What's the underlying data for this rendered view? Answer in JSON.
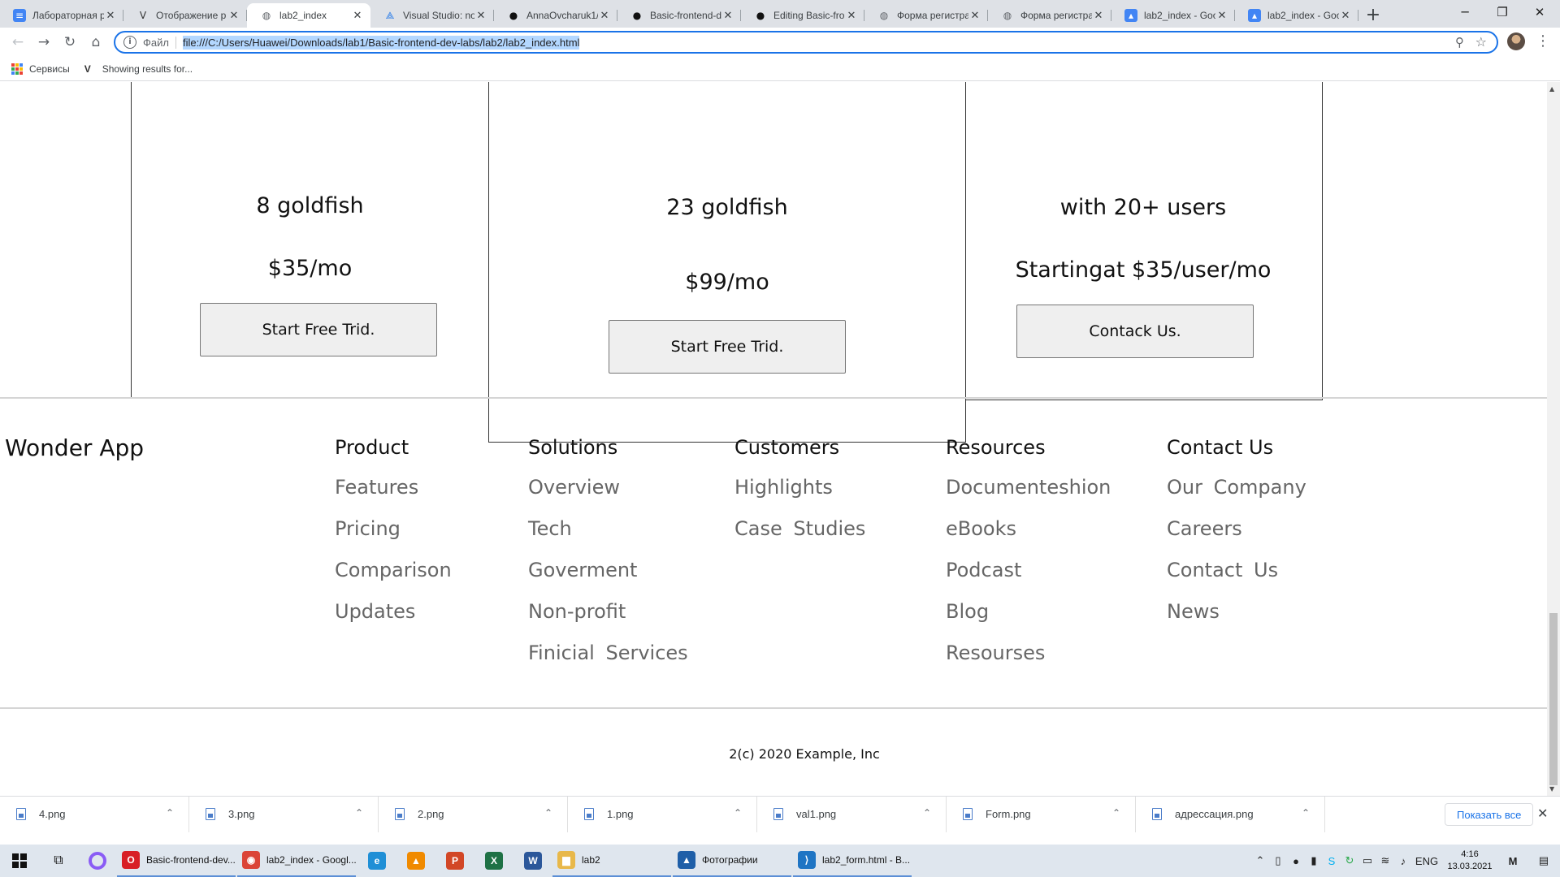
{
  "browser": {
    "tabs": [
      {
        "title": "Лабораторная р",
        "icon": "docs-icon",
        "color": "#4285f4"
      },
      {
        "title": "Отображение р",
        "icon": "v-logo-icon",
        "color": "#333333"
      },
      {
        "title": "lab2_index",
        "icon": "globe-icon",
        "color": "#5f6368",
        "active": true
      },
      {
        "title": "Visual Studio: no",
        "icon": "vscode-icon",
        "color": "#1a73e8"
      },
      {
        "title": "AnnaOvcharuk1/",
        "icon": "github-icon",
        "color": "#111111"
      },
      {
        "title": "Basic-frontend-d",
        "icon": "github-icon",
        "color": "#111111"
      },
      {
        "title": "Editing Basic-fro",
        "icon": "github-icon",
        "color": "#111111"
      },
      {
        "title": "Форма регистра",
        "icon": "globe-icon",
        "color": "#5f6368"
      },
      {
        "title": "Форма регистра",
        "icon": "globe-icon",
        "color": "#5f6368"
      },
      {
        "title": "lab2_index - Goo",
        "icon": "pic-icon",
        "color": "#4285f4"
      },
      {
        "title": "lab2_index - Goo",
        "icon": "pic-icon",
        "color": "#4285f4"
      }
    ],
    "url_scheme_label": "Файл",
    "url": "file:///C:/Users/Huawei/Downloads/lab1/Basic-frontend-dev-labs/lab2/lab2_index.html",
    "bookmarks": {
      "apps_label": "Сервисы",
      "item": "Showing results for..."
    }
  },
  "pricing": {
    "cards": [
      {
        "line1": "8 goldfish",
        "price": "$35/mo",
        "button": "Start Free Trid."
      },
      {
        "line1": "23 goldfish",
        "price": "$99/mo",
        "button": "Start Free Trid."
      },
      {
        "line1": "with 20+ users",
        "price": "Startingat $35/user/mo",
        "button": "Contack Us."
      }
    ]
  },
  "footer": {
    "brand": "Wonder App",
    "columns": [
      {
        "heading": "Product",
        "links": [
          "Features",
          "Pricing",
          "Comparison",
          "Updates"
        ]
      },
      {
        "heading": "Solutions",
        "links": [
          " Overview",
          "Tech",
          " Goverment",
          "Non-profit",
          "Finicial  Services"
        ]
      },
      {
        "heading": "Customers",
        "links": [
          " Highlights",
          "Case  Studies"
        ]
      },
      {
        "heading": " Resources",
        "links": [
          "Documenteshion",
          " eBooks",
          "Podcast",
          "Blog",
          " Resourses"
        ]
      },
      {
        "heading": "Contact  Us",
        "links": [
          "Our  Company",
          "Careers",
          " Contact  Us",
          "  News"
        ]
      }
    ],
    "copyright": "2(c) 2020 Example, Inc"
  },
  "downloads": {
    "items": [
      "4.png",
      "3.png",
      "2.png",
      "1.png",
      "val1.png",
      "Form.png",
      "адрессация.png"
    ],
    "show_all": "Показать все"
  },
  "taskbar": {
    "apps": [
      {
        "label": "Basic-frontend-dev...",
        "icon": "opera-icon",
        "color": "#d81f26",
        "glyph": "O"
      },
      {
        "label": "lab2_index - Googl...",
        "icon": "chrome-icon",
        "color": "#db4437",
        "glyph": "◉"
      },
      {
        "label": "lab2",
        "icon": "folder-icon",
        "color": "#e8b84a",
        "glyph": "▆"
      },
      {
        "label": "Фотографии",
        "icon": "photos-icon",
        "color": "#1f5fa8",
        "glyph": "▲"
      },
      {
        "label": "lab2_form.html - B...",
        "icon": "vscode-icon",
        "color": "#1f75c4",
        "glyph": "⟩"
      }
    ],
    "pinned": [
      {
        "name": "edge-icon",
        "color": "#1f8fd6",
        "glyph": "e"
      },
      {
        "name": "vlc-icon",
        "color": "#f08a00",
        "glyph": "▲"
      },
      {
        "name": "powerpoint-icon",
        "color": "#d24726",
        "glyph": "P"
      },
      {
        "name": "excel-icon",
        "color": "#1e7145",
        "glyph": "X"
      },
      {
        "name": "word-icon",
        "color": "#2b579a",
        "glyph": "W"
      }
    ],
    "lang": "ENG",
    "time": "4:16",
    "date": "13.03.2021"
  }
}
